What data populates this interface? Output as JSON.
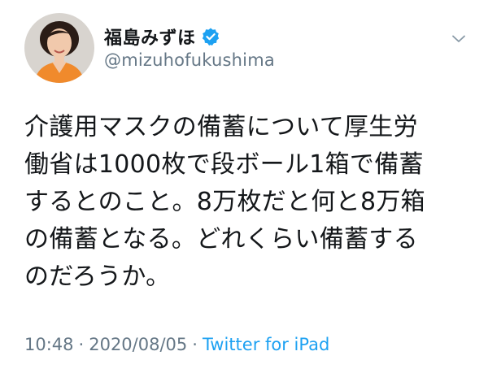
{
  "tweet": {
    "author": {
      "display_name": "福島みずほ",
      "handle": "@mizuhofukushima",
      "verified": true,
      "avatar_icon": "profile-photo"
    },
    "menu_icon": "chevron-down-icon",
    "text_lines": [
      "介護用マスクの備蓄について厚生労",
      "働省は1000枚で段ボール1箱で備蓄",
      "するとのこと。8万枚だと何と8万箱",
      "の備蓄となる。どれくらい備蓄する",
      "のだろうか。"
    ],
    "time": "10:48",
    "separator": "·",
    "date": "2020/08/05",
    "source": "Twitter for iPad"
  },
  "colors": {
    "text": "#14171a",
    "secondary": "#657786",
    "link": "#1da1f2",
    "verified_badge": "#1da1f2"
  }
}
